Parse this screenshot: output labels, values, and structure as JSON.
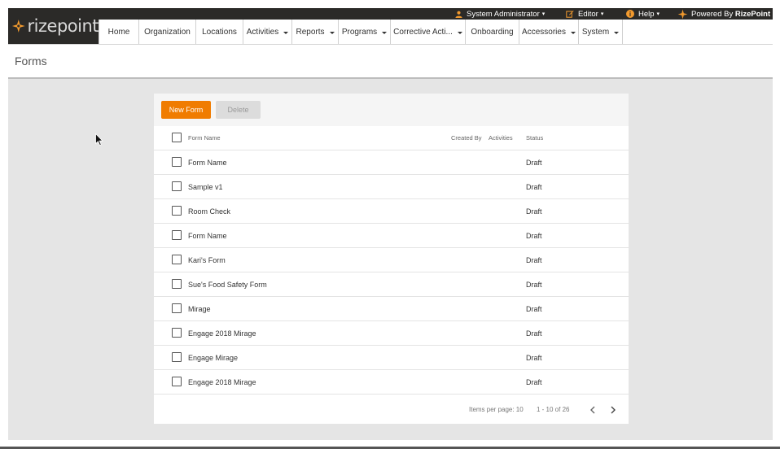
{
  "app": {
    "logo_text": "rizepoint"
  },
  "topbar": {
    "user_label": "System Administrator",
    "editor_label": "Editor",
    "help_label": "Help",
    "info_symbol": "i",
    "powered_prefix": "Powered By",
    "powered_brand": "RizePoint",
    "caret": "▾"
  },
  "nav": {
    "items": [
      {
        "label": "Home",
        "has_dropdown": false
      },
      {
        "label": "Organization",
        "has_dropdown": false
      },
      {
        "label": "Locations",
        "has_dropdown": false
      },
      {
        "label": "Activities",
        "has_dropdown": true
      },
      {
        "label": "Reports",
        "has_dropdown": true
      },
      {
        "label": "Programs",
        "has_dropdown": true
      },
      {
        "label": "Corrective Acti...",
        "has_dropdown": true
      },
      {
        "label": "Onboarding",
        "has_dropdown": false
      },
      {
        "label": "Accessories",
        "has_dropdown": true
      },
      {
        "label": "System",
        "has_dropdown": true
      }
    ]
  },
  "page": {
    "title": "Forms"
  },
  "toolbar": {
    "new_label": "New Form",
    "delete_label": "Delete"
  },
  "table": {
    "columns": {
      "name": "Form Name",
      "created_by": "Created By",
      "activities": "Activities",
      "status": "Status"
    },
    "rows": [
      {
        "name": "Form Name",
        "created_by": "",
        "activities": "",
        "status": "Draft"
      },
      {
        "name": "Sample v1",
        "created_by": "",
        "activities": "",
        "status": "Draft"
      },
      {
        "name": "Room Check",
        "created_by": "",
        "activities": "",
        "status": "Draft"
      },
      {
        "name": "Form Name",
        "created_by": "",
        "activities": "",
        "status": "Draft"
      },
      {
        "name": "Kari's Form",
        "created_by": "",
        "activities": "",
        "status": "Draft"
      },
      {
        "name": "Sue's Food Safety Form",
        "created_by": "",
        "activities": "",
        "status": "Draft"
      },
      {
        "name": "Mirage",
        "created_by": "",
        "activities": "",
        "status": "Draft"
      },
      {
        "name": "Engage 2018 Mirage",
        "created_by": "",
        "activities": "",
        "status": "Draft"
      },
      {
        "name": "Engage Mirage",
        "created_by": "",
        "activities": "",
        "status": "Draft"
      },
      {
        "name": "Engage 2018 Mirage",
        "created_by": "",
        "activities": "",
        "status": "Draft"
      }
    ]
  },
  "pagination": {
    "items_per_page_label": "Items per page: 10",
    "range_label": "1 - 10 of 26"
  },
  "colors": {
    "accent": "#f07c00",
    "header_dark": "#2b2a28",
    "content_bg": "#e5e5e5",
    "logo_star": "#f29a2e"
  },
  "icons": {
    "user": "user-icon",
    "editor": "pencil-edit-icon",
    "help": "info-icon",
    "brand": "rizepoint-star-icon",
    "prev": "chevron-left-icon",
    "next": "chevron-right-icon"
  }
}
